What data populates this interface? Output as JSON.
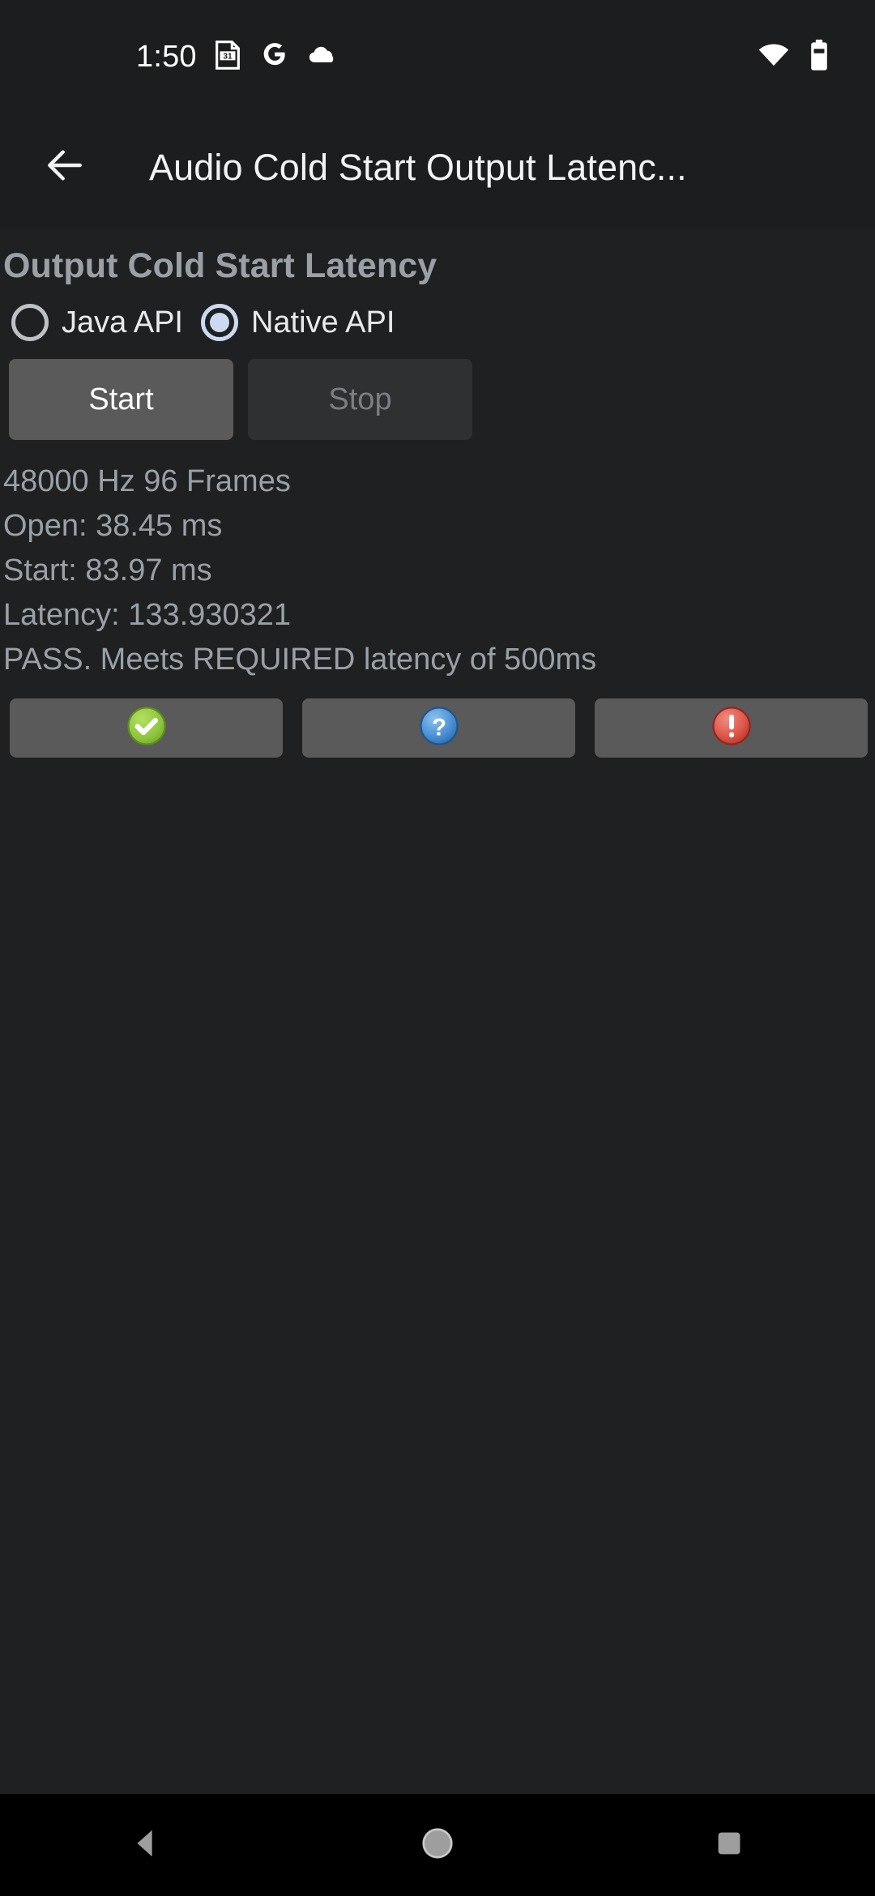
{
  "status_bar": {
    "clock": "1:50",
    "calendar_day": "31",
    "icons_left": [
      "calendar-icon",
      "google-icon",
      "cloud-icon"
    ],
    "icons_right": [
      "wifi-icon",
      "battery-icon"
    ]
  },
  "app_bar": {
    "back_icon": "back-arrow-icon",
    "title": "Audio Cold Start Output Latenc..."
  },
  "main": {
    "section_title": "Output Cold Start Latency",
    "radio_options": [
      {
        "label": "Java API",
        "selected": false
      },
      {
        "label": "Native API",
        "selected": true
      }
    ],
    "buttons": [
      {
        "label": "Start",
        "enabled": true
      },
      {
        "label": "Stop",
        "enabled": false
      }
    ],
    "results": [
      "48000 Hz 96 Frames",
      "Open: 38.45 ms",
      "Start: 83.97 ms",
      "Latency: 133.930321",
      "PASS. Meets REQUIRED latency of 500ms"
    ],
    "icon_buttons": [
      {
        "icon": "pass-check-icon",
        "color": "#8ec63f"
      },
      {
        "icon": "unknown-question-icon",
        "color": "#4a8fd4"
      },
      {
        "icon": "fail-exclamation-icon",
        "color": "#dd5548"
      }
    ]
  },
  "nav_bar": {
    "keys": [
      "back-nav-icon",
      "home-nav-icon",
      "recents-nav-icon"
    ]
  },
  "colors": {
    "window_background": "#1e2021",
    "bar_background": "#1b1d1e",
    "nav_background": "#000000",
    "accent_radio": "#ccd9f0",
    "text_primary": "#e8eaed",
    "text_secondary": "#9aa0a6",
    "button_enabled": "#5a5a5a",
    "button_disabled": "#2e3032"
  }
}
